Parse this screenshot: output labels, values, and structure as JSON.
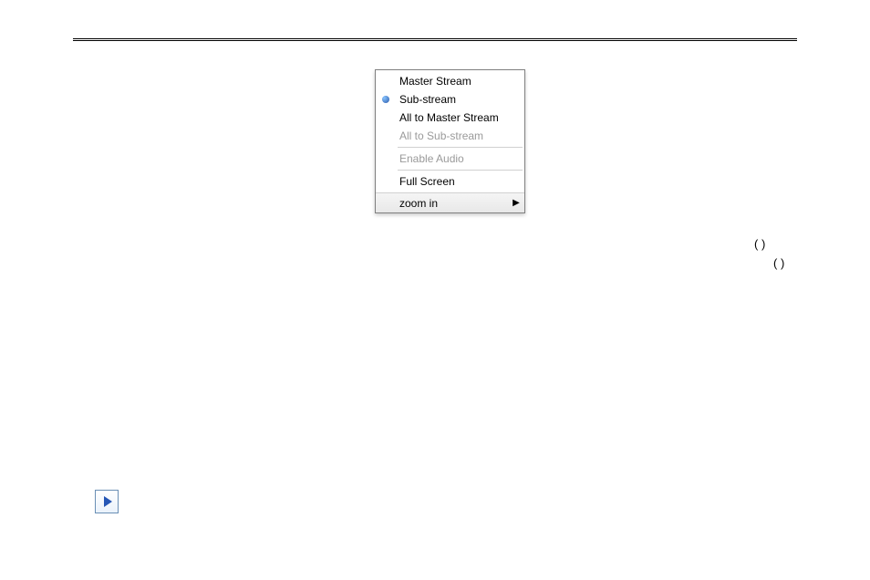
{
  "menu": {
    "items": [
      {
        "label": "Master Stream",
        "selected": false,
        "enabled": true
      },
      {
        "label": "Sub-stream",
        "selected": true,
        "enabled": true
      },
      {
        "label": "All to Master Stream",
        "selected": false,
        "enabled": true
      },
      {
        "label": "All to Sub-stream",
        "selected": false,
        "enabled": false
      }
    ],
    "enableAudio": {
      "label": "Enable Audio",
      "enabled": false
    },
    "fullScreen": {
      "label": "Full Screen",
      "enabled": true
    },
    "zoomIn": {
      "label": "zoom in",
      "hasSubmenu": true
    }
  },
  "parenText1": "(        )",
  "parenText2": "(        )"
}
